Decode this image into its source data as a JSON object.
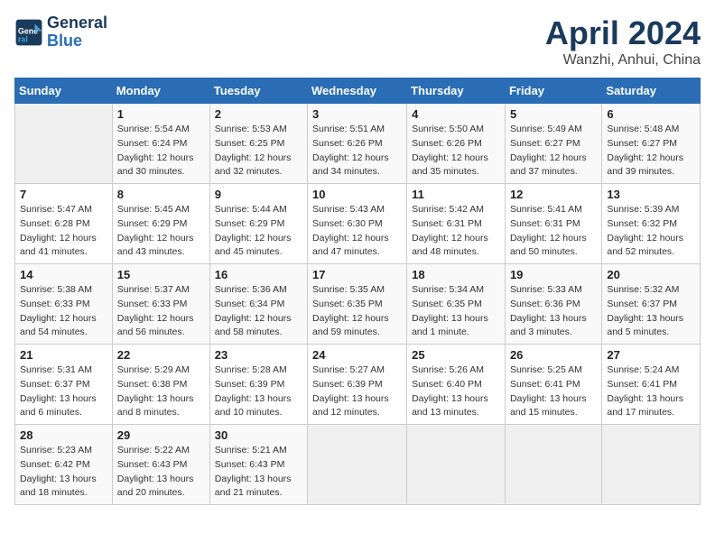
{
  "header": {
    "logo_line1": "General",
    "logo_line2": "Blue",
    "month": "April 2024",
    "location": "Wanzhi, Anhui, China"
  },
  "weekdays": [
    "Sunday",
    "Monday",
    "Tuesday",
    "Wednesday",
    "Thursday",
    "Friday",
    "Saturday"
  ],
  "weeks": [
    [
      {
        "day": "",
        "info": ""
      },
      {
        "day": "1",
        "info": "Sunrise: 5:54 AM\nSunset: 6:24 PM\nDaylight: 12 hours\nand 30 minutes."
      },
      {
        "day": "2",
        "info": "Sunrise: 5:53 AM\nSunset: 6:25 PM\nDaylight: 12 hours\nand 32 minutes."
      },
      {
        "day": "3",
        "info": "Sunrise: 5:51 AM\nSunset: 6:26 PM\nDaylight: 12 hours\nand 34 minutes."
      },
      {
        "day": "4",
        "info": "Sunrise: 5:50 AM\nSunset: 6:26 PM\nDaylight: 12 hours\nand 35 minutes."
      },
      {
        "day": "5",
        "info": "Sunrise: 5:49 AM\nSunset: 6:27 PM\nDaylight: 12 hours\nand 37 minutes."
      },
      {
        "day": "6",
        "info": "Sunrise: 5:48 AM\nSunset: 6:27 PM\nDaylight: 12 hours\nand 39 minutes."
      }
    ],
    [
      {
        "day": "7",
        "info": "Sunrise: 5:47 AM\nSunset: 6:28 PM\nDaylight: 12 hours\nand 41 minutes."
      },
      {
        "day": "8",
        "info": "Sunrise: 5:45 AM\nSunset: 6:29 PM\nDaylight: 12 hours\nand 43 minutes."
      },
      {
        "day": "9",
        "info": "Sunrise: 5:44 AM\nSunset: 6:29 PM\nDaylight: 12 hours\nand 45 minutes."
      },
      {
        "day": "10",
        "info": "Sunrise: 5:43 AM\nSunset: 6:30 PM\nDaylight: 12 hours\nand 47 minutes."
      },
      {
        "day": "11",
        "info": "Sunrise: 5:42 AM\nSunset: 6:31 PM\nDaylight: 12 hours\nand 48 minutes."
      },
      {
        "day": "12",
        "info": "Sunrise: 5:41 AM\nSunset: 6:31 PM\nDaylight: 12 hours\nand 50 minutes."
      },
      {
        "day": "13",
        "info": "Sunrise: 5:39 AM\nSunset: 6:32 PM\nDaylight: 12 hours\nand 52 minutes."
      }
    ],
    [
      {
        "day": "14",
        "info": "Sunrise: 5:38 AM\nSunset: 6:33 PM\nDaylight: 12 hours\nand 54 minutes."
      },
      {
        "day": "15",
        "info": "Sunrise: 5:37 AM\nSunset: 6:33 PM\nDaylight: 12 hours\nand 56 minutes."
      },
      {
        "day": "16",
        "info": "Sunrise: 5:36 AM\nSunset: 6:34 PM\nDaylight: 12 hours\nand 58 minutes."
      },
      {
        "day": "17",
        "info": "Sunrise: 5:35 AM\nSunset: 6:35 PM\nDaylight: 12 hours\nand 59 minutes."
      },
      {
        "day": "18",
        "info": "Sunrise: 5:34 AM\nSunset: 6:35 PM\nDaylight: 13 hours\nand 1 minute."
      },
      {
        "day": "19",
        "info": "Sunrise: 5:33 AM\nSunset: 6:36 PM\nDaylight: 13 hours\nand 3 minutes."
      },
      {
        "day": "20",
        "info": "Sunrise: 5:32 AM\nSunset: 6:37 PM\nDaylight: 13 hours\nand 5 minutes."
      }
    ],
    [
      {
        "day": "21",
        "info": "Sunrise: 5:31 AM\nSunset: 6:37 PM\nDaylight: 13 hours\nand 6 minutes."
      },
      {
        "day": "22",
        "info": "Sunrise: 5:29 AM\nSunset: 6:38 PM\nDaylight: 13 hours\nand 8 minutes."
      },
      {
        "day": "23",
        "info": "Sunrise: 5:28 AM\nSunset: 6:39 PM\nDaylight: 13 hours\nand 10 minutes."
      },
      {
        "day": "24",
        "info": "Sunrise: 5:27 AM\nSunset: 6:39 PM\nDaylight: 13 hours\nand 12 minutes."
      },
      {
        "day": "25",
        "info": "Sunrise: 5:26 AM\nSunset: 6:40 PM\nDaylight: 13 hours\nand 13 minutes."
      },
      {
        "day": "26",
        "info": "Sunrise: 5:25 AM\nSunset: 6:41 PM\nDaylight: 13 hours\nand 15 minutes."
      },
      {
        "day": "27",
        "info": "Sunrise: 5:24 AM\nSunset: 6:41 PM\nDaylight: 13 hours\nand 17 minutes."
      }
    ],
    [
      {
        "day": "28",
        "info": "Sunrise: 5:23 AM\nSunset: 6:42 PM\nDaylight: 13 hours\nand 18 minutes."
      },
      {
        "day": "29",
        "info": "Sunrise: 5:22 AM\nSunset: 6:43 PM\nDaylight: 13 hours\nand 20 minutes."
      },
      {
        "day": "30",
        "info": "Sunrise: 5:21 AM\nSunset: 6:43 PM\nDaylight: 13 hours\nand 21 minutes."
      },
      {
        "day": "",
        "info": ""
      },
      {
        "day": "",
        "info": ""
      },
      {
        "day": "",
        "info": ""
      },
      {
        "day": "",
        "info": ""
      }
    ]
  ]
}
